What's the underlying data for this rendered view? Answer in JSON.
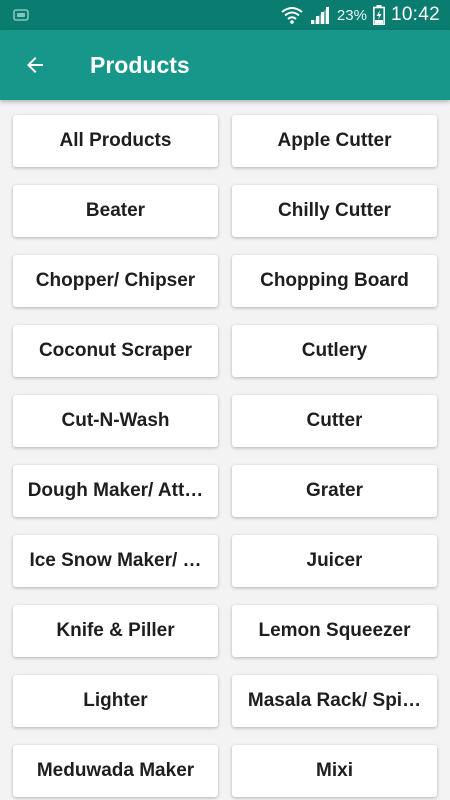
{
  "status_bar": {
    "battery_percent": "23%",
    "time": "10:42",
    "icons": [
      "notification-icon",
      "wifi-icon",
      "signal-icon",
      "battery-charging-icon"
    ]
  },
  "app_bar": {
    "title": "Products",
    "back_icon": "arrow-left-icon",
    "color": "#16978a"
  },
  "products": [
    "All Products",
    "Apple Cutter",
    "Beater",
    "Chilly Cutter",
    "Chopper/ Chipser",
    "Chopping Board",
    "Coconut Scraper",
    "Cutlery",
    "Cut-N-Wash",
    "Cutter",
    "Dough Maker/ Att…",
    "Grater",
    "Ice Snow Maker/ …",
    "Juicer",
    "Knife & Piller",
    "Lemon Squeezer",
    "Lighter",
    "Masala Rack/ Spi…",
    "Meduwada Maker",
    "Mixi"
  ]
}
